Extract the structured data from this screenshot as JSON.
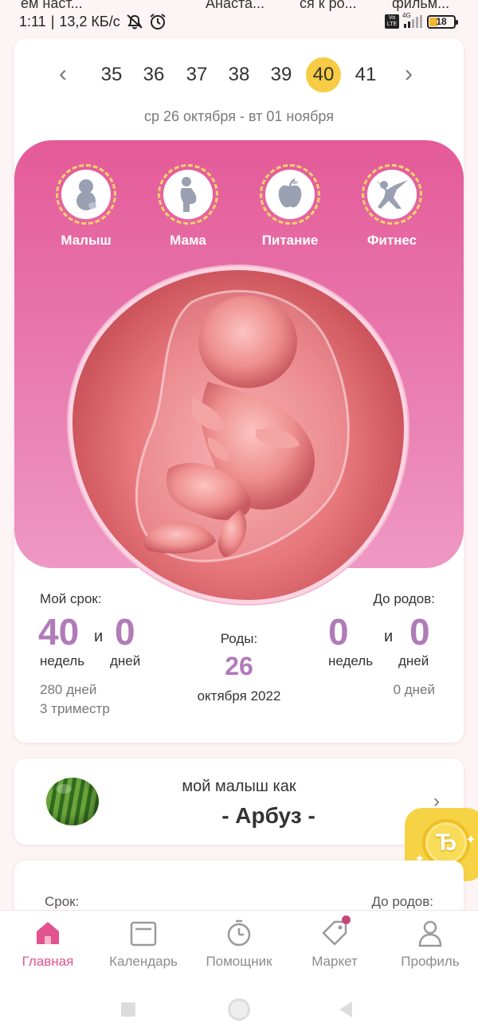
{
  "notifications": [
    "ем наст...",
    "Анаста...",
    "ся к ро...",
    "фильм..."
  ],
  "status": {
    "time": "1:11",
    "speed": "13,2 КБ/с",
    "network": "4G",
    "volte": "Vo LTE",
    "battery": "18"
  },
  "weeks": {
    "items": [
      "35",
      "36",
      "37",
      "38",
      "39",
      "40",
      "41"
    ],
    "active": "40",
    "range": "ср 26 октября - вт 01 ноября"
  },
  "categories": [
    {
      "label": "Малыш",
      "icon": "baby-icon"
    },
    {
      "label": "Мама",
      "icon": "mother-icon"
    },
    {
      "label": "Питание",
      "icon": "apple-icon"
    },
    {
      "label": "Фитнес",
      "icon": "fitness-icon"
    }
  ],
  "term": {
    "label": "Мой срок:",
    "weeks": "40",
    "and": "и",
    "days": "0",
    "weeks_unit": "недель",
    "days_unit": "дней",
    "total": "280 дней",
    "trimester": "3 триместр"
  },
  "birth": {
    "label": "Роды:",
    "day": "26",
    "month_year": "октября 2022"
  },
  "until": {
    "label": "До родов:",
    "weeks": "0",
    "and": "и",
    "days": "0",
    "weeks_unit": "недель",
    "days_unit": "дней",
    "total": "0 дней"
  },
  "fruit": {
    "line1": "мой малыш как",
    "name": "- Арбуз -"
  },
  "bottom_card": {
    "left": "Срок:",
    "right": "До родов:"
  },
  "coin": {
    "symbol": "Ђ"
  },
  "nav": [
    {
      "label": "Главная",
      "icon": "home-icon",
      "active": true
    },
    {
      "label": "Календарь",
      "icon": "calendar-icon"
    },
    {
      "label": "Помощник",
      "icon": "timer-icon"
    },
    {
      "label": "Маркет",
      "icon": "tag-icon"
    },
    {
      "label": "Профиль",
      "icon": "profile-icon"
    }
  ],
  "colors": {
    "accent": "#e2538f",
    "pink_top": "#e45a98",
    "pink_bottom": "#ef98c4",
    "highlight": "#f7cb43",
    "number": "#b07bb8"
  }
}
